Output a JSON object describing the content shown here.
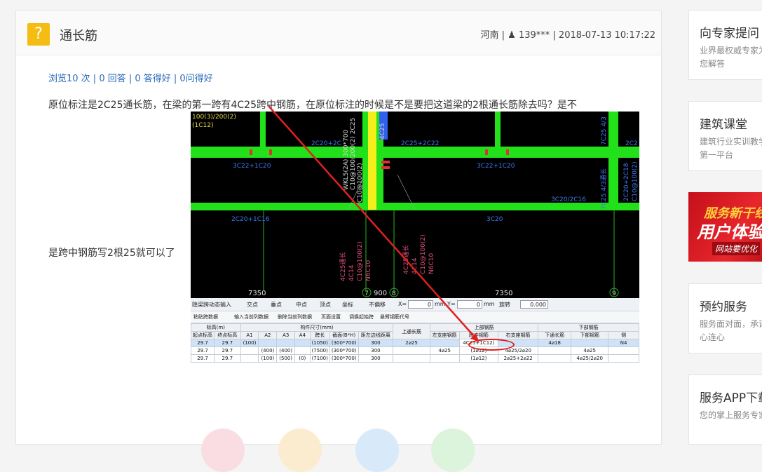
{
  "question": {
    "icon": "question-mark-icon",
    "icon_glyph": "?",
    "title": "通长筋",
    "meta": "河南 | ♟ 139*** | 2018-07-13 10:17:22",
    "stats": "浏览10 次 | 0 回答 | 0 答得好 | 0问得好",
    "body_line1": "原位标注是2C25通长筋，在梁的第一跨有4C25跨中钢筋，在原位标注的时候是不是要把这道梁的2根通长筋除去吗？是不",
    "body_line2": "是跨中钢筋写2根25就可以了"
  },
  "screenshot": {
    "cad_labels": {
      "t1": "100(3)/200(2)",
      "t2": "(1C12)",
      "t3": "2C20+2C",
      "t4": "2C25+2C22",
      "t5": "2C2",
      "t6": "3C22+1C20",
      "t7": "3C22+1C20",
      "t8": "3C20/2C16",
      "t9": "2C20+1C16",
      "t10": "3C20",
      "v1": "WKL5(2A) 300*700",
      "v2": "C10@100/200(2) 2C25",
      "v3": "C10@100(2)",
      "v4": "4C25",
      "v5": "7C25 4/3",
      "v6": "7C25 4/3通长",
      "v7": "2C20+2C18",
      "v8": "C10@100(2)",
      "v9": "4C25通长",
      "v10": "4C14",
      "v11": "C10@100(2)",
      "v12": "N6C10",
      "v13": "4C25通长",
      "v14": "4C14",
      "v15": "C10@100(2)",
      "v16": "N6C10",
      "d1": "7350",
      "d2": "900",
      "d3": "7350",
      "g1": "7",
      "g2": "8",
      "g3": "9"
    },
    "toolbar": {
      "b1": "隐梁跨",
      "b2": "动态输入",
      "b3": "交点",
      "b4": "垂点",
      "b5": "中点",
      "b6": "顶点",
      "b7": "坐标",
      "b8": "不偏移",
      "b9": "X=",
      "v9": "0",
      "u9": "mm",
      "b10": "Y=",
      "v10": "0",
      "u10": "mm",
      "b11": "旋转",
      "v11": "0.000"
    },
    "toolbar2": [
      "粘贴跨数据",
      "输入当前列数据",
      "删除当前列数据",
      "页面设置",
      "调换起始跨",
      "悬臂钢筋代号"
    ],
    "table": {
      "group_headers": [
        "标高(m)",
        "构件尺寸(mm)",
        "上通长筋",
        "上部钢筋",
        "下部钢筋"
      ],
      "headers": [
        "起点标高",
        "终点标高",
        "A1",
        "A2",
        "A3",
        "A4",
        "跨长",
        "截面(B*H)",
        "距左边线距离",
        "",
        "左支座钢筋",
        "跨中钢筋",
        "右支座钢筋",
        "下通长筋",
        "下部钢筋",
        "侧"
      ],
      "rows": [
        [
          "29.7",
          "29.7",
          "(100)",
          "",
          "",
          "",
          "(1050)",
          "(300*700)",
          "300",
          "2⌀25",
          "",
          "4C25+1C12)",
          "",
          "4⌀18",
          "",
          "N4"
        ],
        [
          "29.7",
          "29.7",
          "",
          "(400)",
          "(400)",
          "",
          "(7500)",
          "(300*700)",
          "300",
          "",
          "4⌀25",
          "(1⌀12)",
          "4⌀25/2⌀20",
          "",
          "4⌀25",
          ""
        ],
        [
          "29.7",
          "29.7",
          "",
          "(100)",
          "(500)",
          "(0)",
          "(7100)",
          "(300*700)",
          "300",
          "",
          "",
          "(1⌀12)",
          "2⌀25+2⌀22",
          "",
          "4⌀25/2⌀20",
          ""
        ]
      ]
    }
  },
  "sidebar": {
    "s1": {
      "title": "向专家提问",
      "desc": "业界最权威专家为您解答"
    },
    "s2": {
      "title": "建筑课堂",
      "desc": "建筑行业实训教学第一平台"
    },
    "banner": {
      "l1": "服务新干线",
      "l2": "用户体验",
      "l3": "网站要优化"
    },
    "s3": {
      "title": "预约服务",
      "desc": "服务面对面，承诺心连心"
    },
    "s4": {
      "title": "服务APP下载",
      "desc": "您的掌上服务专家"
    }
  },
  "colors": {
    "beam": "#22e01a",
    "column": "#1fb81a",
    "label": "#3d78f0",
    "annotation": "#e0507a",
    "arrow": "#e02020",
    "icon": "#f5bd14"
  }
}
